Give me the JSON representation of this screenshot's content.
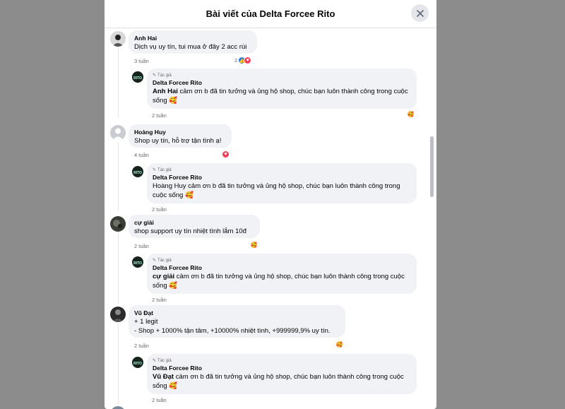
{
  "header": {
    "title": "Bài viết của Delta Forcee Rito"
  },
  "author_tag": "Tác giả",
  "comments": [
    {
      "name": "Anh Hai",
      "text": "Dịch vụ uy tín, tui mua ở đây 2 acc rùi",
      "time": "3 tuần",
      "react_count": "2"
    },
    {
      "name": "Delta Forcee Rito",
      "mention": "Anh Hai",
      "text": " cảm ơn b đã tin tưởng và ủng hộ shop, chúc bạn luôn thành công trong cuộc sống 🥰",
      "time": "2 tuần"
    },
    {
      "name": "Hoàng Huy",
      "text": "Shop uy tín, hỗ trợ tận tình ạ!",
      "time": "4 tuần"
    },
    {
      "name": "Delta Forcee Rito",
      "text": "Hoàng Huy cảm ơn b đã tin tưởng và ủng hộ shop, chúc bạn luôn thành công trong cuộc sống 🥰",
      "time": "2 tuần"
    },
    {
      "name": "cự giải",
      "text": "shop support uy tín nhiệt tình lắm 10đ",
      "time": "2 tuần"
    },
    {
      "name": "Delta Forcee Rito",
      "mention": "cự giải",
      "text": " cảm ơn b đã tin tưởng và ủng hộ shop, chúc bạn luôn thành công trong cuộc sống 🥰",
      "time": "2 tuần"
    },
    {
      "name": "Vũ Đạt",
      "line1": "+ 1 legit",
      "line2": "- Shop + 1000% tận tâm, +10000% nhiệt tình, +999999,9% uy tín.",
      "time": "2 tuần"
    },
    {
      "name": "Delta Forcee Rito",
      "mention": "Vũ Đạt",
      "text": " cảm ơn b đã tin tưởng và ủng hộ shop, chúc bạn luôn thành công trong cuộc sống 🥰",
      "time": "2 tuần"
    }
  ],
  "colors": {
    "like": "#1877f2",
    "love": "#f33e58",
    "care": "#f7b125",
    "bubble": "#f0f2f5"
  }
}
